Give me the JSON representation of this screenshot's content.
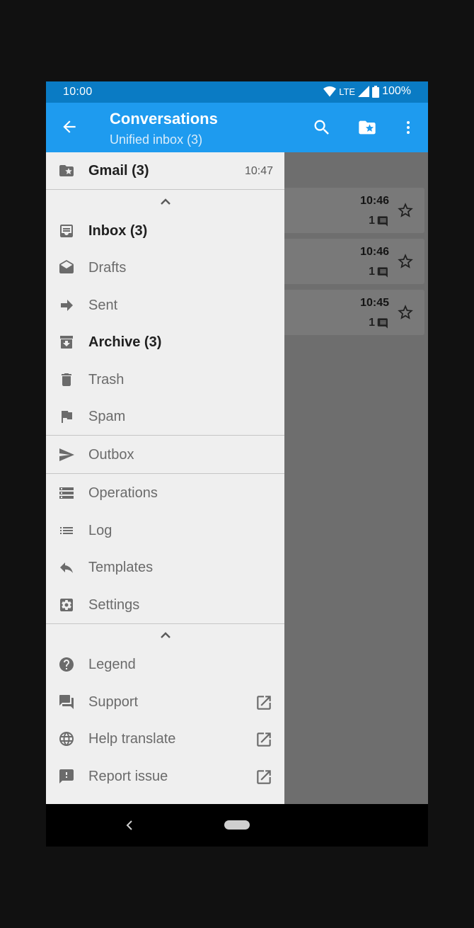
{
  "status": {
    "time": "10:00",
    "network": "LTE",
    "battery": "100%"
  },
  "appbar": {
    "title": "Conversations",
    "subtitle": "Unified inbox (3)"
  },
  "messages": [
    {
      "time": "10:46",
      "count": "1"
    },
    {
      "time": "10:46",
      "count": "1"
    },
    {
      "time": "10:45",
      "count": "1"
    }
  ],
  "drawer": {
    "account": {
      "label": "Gmail (3)",
      "time": "10:47"
    },
    "folders": {
      "inbox": "Inbox (3)",
      "drafts": "Drafts",
      "sent": "Sent",
      "archive": "Archive (3)",
      "trash": "Trash",
      "spam": "Spam"
    },
    "outbox": "Outbox",
    "tools": {
      "operations": "Operations",
      "log": "Log",
      "templates": "Templates",
      "settings": "Settings"
    },
    "help": {
      "legend": "Legend",
      "support": "Support",
      "translate": "Help translate",
      "report": "Report issue"
    }
  },
  "colors": {
    "primary": "#1e9bef",
    "primary_dark": "#0a7bc4",
    "drawer_bg": "#efefef",
    "fab": "#8a6300"
  }
}
